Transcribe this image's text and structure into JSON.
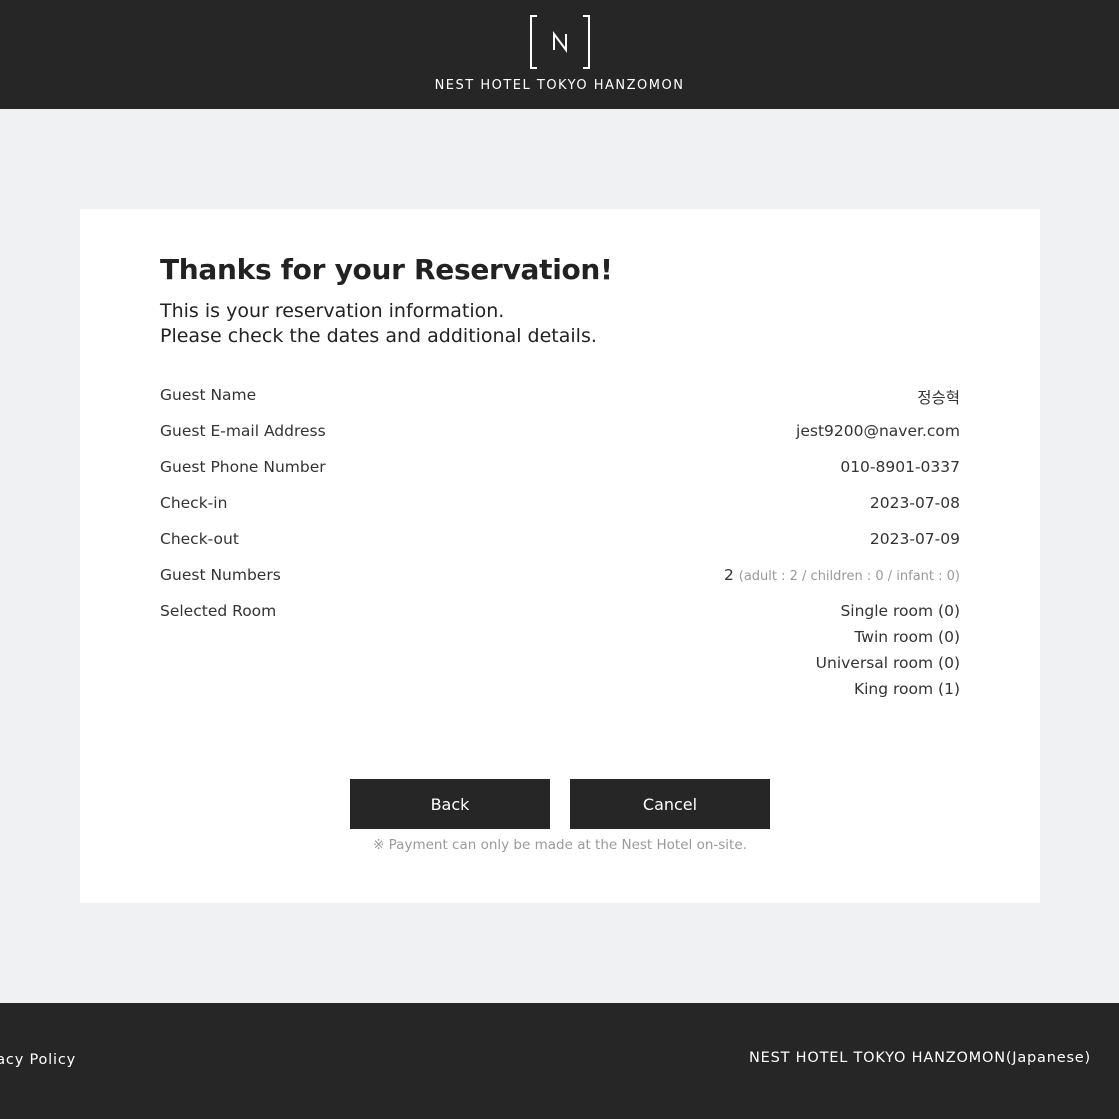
{
  "header": {
    "logo_icon": "nest-n-bracket-logo",
    "brand_title": "NEST HOTEL TOKYO HANZOMON"
  },
  "confirmation": {
    "heading": "Thanks for your Reservation!",
    "intro_line1": "This is your reservation information.",
    "intro_line2": "Please check the dates and additional details.",
    "guest_name_label": "Guest Name",
    "guest_name_value": "정승혁",
    "email_label": "Guest E-mail Address",
    "email_value": "jest9200@naver.com",
    "phone_label": "Guest Phone Number",
    "phone_value": "010-8901-0337",
    "checkin_label": "Check-in",
    "checkin_value": "2023-07-08",
    "checkout_label": "Check-out",
    "checkout_value": "2023-07-09",
    "guests_label": "Guest Numbers",
    "guests_total": "2",
    "guests_breakdown": "(adult : 2 / children : 0 / infant : 0)",
    "rooms_label": "Selected Room",
    "rooms": [
      "Single room (0)",
      "Twin room (0)",
      "Universal room (0)",
      "King room (1)"
    ],
    "back_label": "Back",
    "cancel_label": "Cancel",
    "payment_note": "※ Payment can only be made at the Nest Hotel on-site."
  },
  "footer": {
    "left_link": "acy Policy",
    "right_link": "NEST HOTEL TOKYO HANZOMON(Japanese)"
  },
  "colors": {
    "dark": "#262626",
    "background": "#f0f1f3",
    "card": "#ffffff",
    "muted": "#9a9a9a"
  }
}
